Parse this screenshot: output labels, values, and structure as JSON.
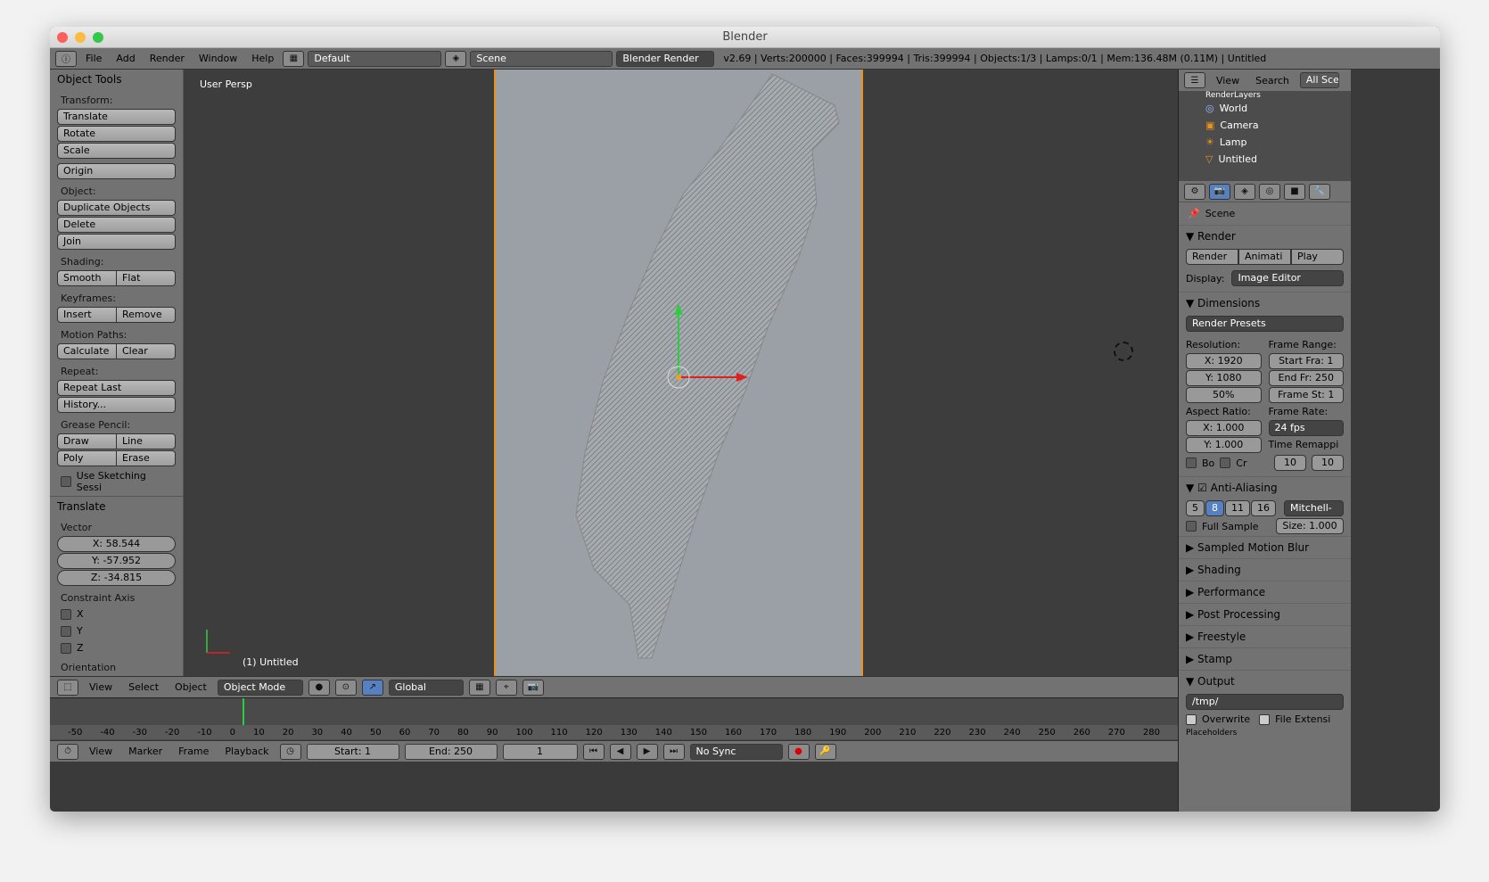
{
  "window": {
    "title": "Blender"
  },
  "menubar": {
    "items": [
      "File",
      "Add",
      "Render",
      "Window",
      "Help"
    ],
    "layout": "Default",
    "scene": "Scene",
    "engine": "Blender Render",
    "stats": "v2.69 | Verts:200000 | Faces:399994 | Tris:399994 | Objects:1/3 | Lamps:0/1 | Mem:136.48M (0.11M) | Untitled"
  },
  "tools": {
    "title": "Object Tools",
    "transform_label": "Transform:",
    "translate": "Translate",
    "rotate": "Rotate",
    "scale": "Scale",
    "origin": "Origin",
    "object_label": "Object:",
    "duplicate": "Duplicate Objects",
    "delete": "Delete",
    "join": "Join",
    "shading_label": "Shading:",
    "smooth": "Smooth",
    "flat": "Flat",
    "keyframes_label": "Keyframes:",
    "insert": "Insert",
    "remove": "Remove",
    "motion_label": "Motion Paths:",
    "calculate": "Calculate",
    "clear": "Clear",
    "repeat_label": "Repeat:",
    "repeat_last": "Repeat Last",
    "history": "History...",
    "grease_label": "Grease Pencil:",
    "draw": "Draw",
    "line": "Line",
    "poly": "Poly",
    "erase": "Erase",
    "sketch": "Use Sketching Sessi",
    "translate_panel": "Translate",
    "vector_label": "Vector",
    "vx": "X: 58.544",
    "vy": "Y: -57.952",
    "vz": "Z: -34.815",
    "constraint_label": "Constraint Axis",
    "cx": "X",
    "cy": "Y",
    "cz": "Z",
    "orientation_label": "Orientation"
  },
  "viewport": {
    "view_label": "User Persp",
    "object_label": "(1) Untitled"
  },
  "outliner": {
    "view": "View",
    "search": "Search",
    "scenes": "All Scen",
    "items": [
      "RenderLayers",
      "World",
      "Camera",
      "Lamp",
      "Untitled"
    ]
  },
  "props": {
    "scene": "Scene",
    "render": "Render",
    "render_btn": "Render",
    "anim_btn": "Animati",
    "play_btn": "Play",
    "display_label": "Display:",
    "display": "Image Editor",
    "dimensions": "Dimensions",
    "presets": "Render Presets",
    "resolution_label": "Resolution:",
    "framerange_label": "Frame Range:",
    "resx": "X: 1920",
    "resy": "Y: 1080",
    "respct": "50%",
    "start": "Start Fra: 1",
    "end": "End Fr: 250",
    "step": "Frame St: 1",
    "aspect_label": "Aspect Ratio:",
    "framerate_label": "Frame Rate:",
    "ax": "X: 1.000",
    "ay": "Y: 1.000",
    "fps": "24 fps",
    "remap_label": "Time Remappi",
    "bo": "Bo",
    "cr": "Cr",
    "remap_old": "10",
    "remap_new": "10",
    "aa": "Anti-Aliasing",
    "aa5": "5",
    "aa8": "8",
    "aa11": "11",
    "aa16": "16",
    "filter": "Mitchell-Net",
    "fullsample": "Full Sample",
    "size": "Size: 1.000",
    "motionblur": "Sampled Motion Blur",
    "shading": "Shading",
    "performance": "Performance",
    "postproc": "Post Processing",
    "freestyle": "Freestyle",
    "stamp": "Stamp",
    "output": "Output",
    "path": "/tmp/",
    "overwrite": "Overwrite",
    "fileext": "File Extensi",
    "placeholders": "Placeholders"
  },
  "vpheader": {
    "view": "View",
    "select": "Select",
    "object": "Object",
    "mode": "Object Mode",
    "orientation": "Global"
  },
  "timeline": {
    "ticks": [
      "-50",
      "-40",
      "-30",
      "-20",
      "-10",
      "0",
      "10",
      "20",
      "30",
      "40",
      "50",
      "60",
      "70",
      "80",
      "90",
      "100",
      "110",
      "120",
      "130",
      "140",
      "150",
      "160",
      "170",
      "180",
      "190",
      "200",
      "210",
      "220",
      "230",
      "240",
      "250",
      "260",
      "270",
      "280"
    ],
    "view": "View",
    "marker": "Marker",
    "frame": "Frame",
    "playback": "Playback",
    "start": "Start: 1",
    "end": "End: 250",
    "current": "1",
    "sync": "No Sync"
  },
  "colors": {
    "accent": "#5680c2",
    "orange": "#e8941c",
    "panel": "#727272"
  }
}
